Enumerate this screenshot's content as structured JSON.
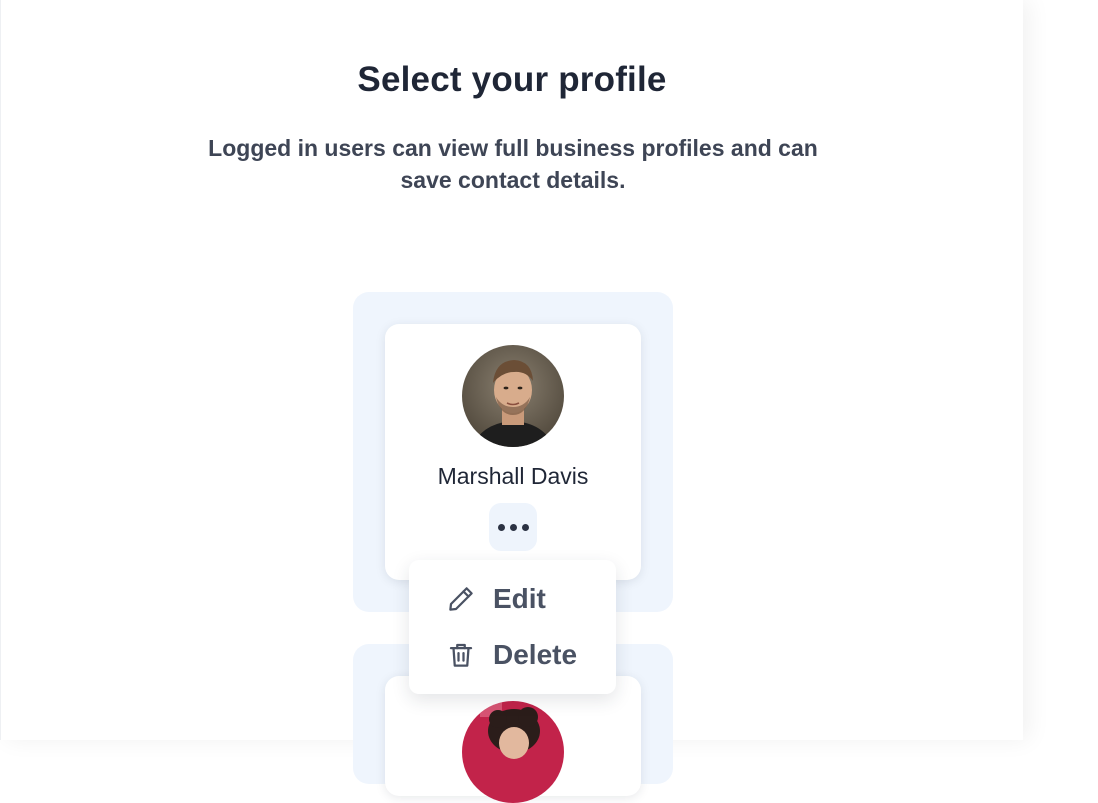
{
  "header": {
    "title": "Select your profile",
    "subtitle": "Logged in users can view full business profiles and can save contact details."
  },
  "profiles": [
    {
      "name": "Marshall Davis",
      "more_icon": "more-horizontal-icon"
    },
    {
      "name": "",
      "more_icon": ""
    }
  ],
  "menu": {
    "items": [
      {
        "label": "Edit",
        "icon": "pencil-icon"
      },
      {
        "label": "Delete",
        "icon": "trash-icon"
      }
    ]
  },
  "colors": {
    "title": "#1f2636",
    "subtitle": "#3e4555",
    "tile_background": "#eff5fd",
    "menu_text": "#4a5263"
  }
}
